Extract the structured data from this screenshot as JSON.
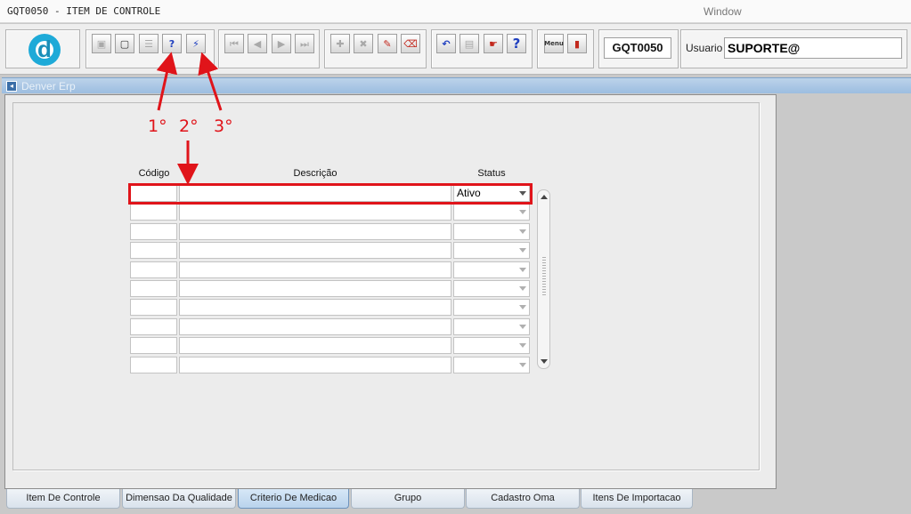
{
  "window": {
    "title": "GQT0050 - ITEM DE CONTROLE",
    "menu": [
      "Window"
    ]
  },
  "toolbar": {
    "logo_letter": "d",
    "form_code": "GQT0050",
    "usuario_label": "Usuario",
    "usuario_value": "SUPORTE@",
    "buttons": [
      {
        "name": "save",
        "icon": "floppy-disk-icon",
        "enabled": false
      },
      {
        "name": "window",
        "icon": "window-icon",
        "enabled": true
      },
      {
        "name": "print",
        "icon": "printer-icon",
        "enabled": false
      },
      {
        "name": "enter-query",
        "icon": "query-enter-icon",
        "enabled": true
      },
      {
        "name": "execute-query",
        "icon": "query-execute-icon",
        "enabled": true
      },
      {
        "name": "first-record",
        "icon": "first-record-icon",
        "enabled": false
      },
      {
        "name": "previous-record",
        "icon": "previous-record-icon",
        "enabled": false
      },
      {
        "name": "next-record",
        "icon": "next-record-icon",
        "enabled": false
      },
      {
        "name": "last-record",
        "icon": "last-record-icon",
        "enabled": false
      },
      {
        "name": "insert-record",
        "icon": "plus-icon",
        "enabled": false
      },
      {
        "name": "delete-record",
        "icon": "x-icon",
        "enabled": false
      },
      {
        "name": "edit-record",
        "icon": "edit-record-icon",
        "enabled": true
      },
      {
        "name": "clear-record",
        "icon": "eraser-icon",
        "enabled": true
      },
      {
        "name": "undo",
        "icon": "undo-icon",
        "enabled": true
      },
      {
        "name": "clipboard",
        "icon": "clipboard-icon",
        "enabled": false
      },
      {
        "name": "lov",
        "icon": "list-pointer-icon",
        "enabled": true
      },
      {
        "name": "help",
        "icon": "question-icon",
        "enabled": true
      },
      {
        "name": "menu",
        "icon": "menu-icon",
        "label": "Menu",
        "enabled": true
      },
      {
        "name": "exit",
        "icon": "exit-door-icon",
        "enabled": true
      }
    ]
  },
  "inner_window": {
    "title": "Denver Erp"
  },
  "grid": {
    "columns": {
      "codigo": "Código",
      "descricao": "Descrição",
      "status": "Status"
    },
    "rows": [
      {
        "codigo": "",
        "descricao": "",
        "status": "Ativo"
      },
      {
        "codigo": "",
        "descricao": "",
        "status": ""
      },
      {
        "codigo": "",
        "descricao": "",
        "status": ""
      },
      {
        "codigo": "",
        "descricao": "",
        "status": ""
      },
      {
        "codigo": "",
        "descricao": "",
        "status": ""
      },
      {
        "codigo": "",
        "descricao": "",
        "status": ""
      },
      {
        "codigo": "",
        "descricao": "",
        "status": ""
      },
      {
        "codigo": "",
        "descricao": "",
        "status": ""
      },
      {
        "codigo": "",
        "descricao": "",
        "status": ""
      },
      {
        "codigo": "",
        "descricao": "",
        "status": ""
      }
    ]
  },
  "annotations": {
    "step1": "1°",
    "step2": "2°",
    "step3": "3°",
    "color": "#e0141a"
  },
  "tabs": [
    {
      "label": "Item De Controle",
      "active": false
    },
    {
      "label": "Dimensao Da Qualidade",
      "active": false
    },
    {
      "label": "Criterio De Medicao",
      "active": true
    },
    {
      "label": "Grupo",
      "active": false
    },
    {
      "label": "Cadastro Oma",
      "active": false
    },
    {
      "label": "Itens De Importacao",
      "active": false
    }
  ]
}
